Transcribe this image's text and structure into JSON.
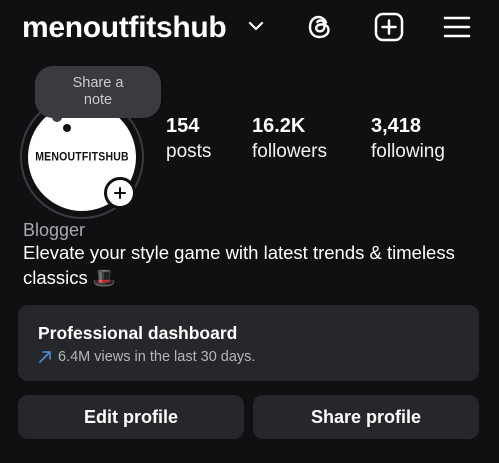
{
  "header": {
    "username": "menoutfitshub"
  },
  "note": {
    "line1": "Share a",
    "line2": "note"
  },
  "avatar": {
    "brand_text": "MENOUTFITSHUB"
  },
  "stats": {
    "posts": {
      "value": "154",
      "label": "posts"
    },
    "followers": {
      "value": "16.2K",
      "label": "followers"
    },
    "following": {
      "value": "3,418",
      "label": "following"
    }
  },
  "bio": {
    "category": "Blogger",
    "text": "Elevate your style game with latest trends & timeless classics 🎩"
  },
  "dashboard": {
    "title": "Professional dashboard",
    "subtitle": "6.4M views in the last 30 days.",
    "trend_icon": "trending-up-icon",
    "trend_color": "#4a8fd6"
  },
  "actions": {
    "edit_label": "Edit profile",
    "share_label": "Share profile"
  },
  "colors": {
    "background": "#0f1012",
    "card": "#26272b",
    "bubble": "#3a3b3e",
    "muted_text": "#a8a9ad"
  }
}
